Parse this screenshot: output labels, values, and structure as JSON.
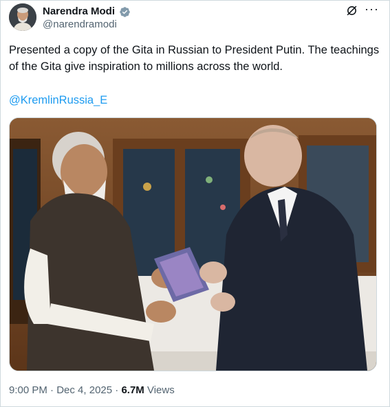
{
  "post": {
    "author_name": "Narendra Modi",
    "author_handle": "@narendramodi",
    "text": "Presented a copy of the Gita in Russian to President Putin. The teachings of the Gita give inspiration to millions across the world.",
    "mention": "@KremlinRussia_E",
    "time": "9:00 PM",
    "separator": "·",
    "date": "Dec 4, 2025",
    "views_count": "6.7M",
    "views_label": "Views"
  },
  "icons": {
    "verified": "verified-badge-icon",
    "grok": "grok-icon",
    "more": "more-options-icon"
  },
  "colors": {
    "link": "#1d9bf0",
    "secondary_text": "#536471",
    "primary_text": "#0f1419",
    "verified_badge": "#829aab"
  }
}
